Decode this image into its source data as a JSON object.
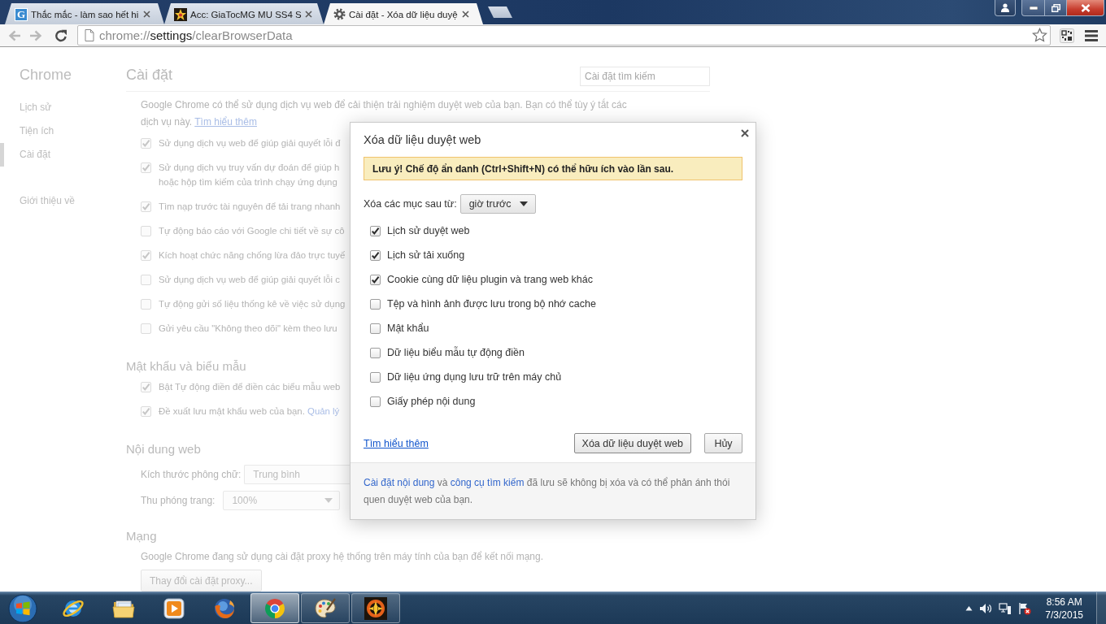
{
  "tabs": [
    {
      "title": "Thắc mắc - làm sao hết hi",
      "kind": "letter",
      "favicon_letter": "G",
      "selected": false
    },
    {
      "title": "Acc: GiaTocMG MU SS4 S",
      "kind": "emblem",
      "selected": false
    },
    {
      "title": "Cài đặt - Xóa dữ liệu duyệ",
      "kind": "gear",
      "selected": true
    }
  ],
  "toolbar": {
    "back_disabled": true,
    "forward_disabled": true,
    "address": {
      "scheme": "chrome://",
      "host": "settings",
      "path": "/clearBrowserData"
    }
  },
  "settings_page": {
    "nav_title": "Chrome",
    "nav_items": [
      {
        "label": "Lịch sử",
        "selected": false
      },
      {
        "label": "Tiện ích",
        "selected": false
      },
      {
        "label": "Cài đặt",
        "selected": true
      }
    ],
    "nav_more_items": [
      {
        "label": "Giới thiệu về",
        "selected": false
      }
    ],
    "title": "Cài đặt",
    "search": {
      "placeholder": "Cài đặt tìm kiếm"
    },
    "intro": [
      {
        "kind": "text",
        "text": "Google Chrome có thể sử dụng dịch vụ web để cải thiện trải nghiệm duyệt web của bạn. Bạn có thể tùy ý tắt các dịch vụ này. "
      },
      {
        "kind": "link",
        "text": "Tìm hiểu thêm"
      }
    ],
    "privacy_options": [
      {
        "lines": [
          "Sử dụng dịch vụ web để giúp giải quyết lỗi đ"
        ],
        "checked": true
      },
      {
        "lines": [
          "Sử dụng dịch vụ truy vấn dự đoán để giúp h",
          "hoặc hộp tìm kiếm của trình chạy ứng dụng"
        ],
        "checked": true
      },
      {
        "lines": [
          "Tìm nạp trước tài nguyên để tải trang nhanh"
        ],
        "checked": true
      },
      {
        "lines": [
          "Tự động báo cáo với Google chi tiết về sự cô"
        ],
        "checked": false
      },
      {
        "lines": [
          "Kích hoạt chức năng chống lừa đảo trực tuyế"
        ],
        "checked": true
      },
      {
        "lines": [
          "Sử dụng dịch vụ web để giúp giải quyết lỗi c"
        ],
        "checked": false
      },
      {
        "lines": [
          "Tự động gửi số liệu thống kê về việc sử dụng"
        ],
        "checked": false
      },
      {
        "lines": [
          "Gửi yêu cầu \"Không theo dõi\" kèm theo lưu"
        ],
        "checked": false
      }
    ],
    "sections": [
      {
        "heading": "Mật khẩu và biểu mẫu",
        "items": [
          {
            "kind": "checkbox",
            "checked": true,
            "parts": [
              {
                "kind": "text",
                "text": "Bật Tự động điền để điền các biểu mẫu web"
              }
            ]
          },
          {
            "kind": "checkbox",
            "checked": true,
            "parts": [
              {
                "kind": "text",
                "text": "Đề xuất lưu mật khẩu web của bạn. "
              },
              {
                "kind": "link",
                "text": "Quản lý"
              }
            ]
          }
        ]
      },
      {
        "heading": "Nội dung web",
        "items": [
          {
            "kind": "select",
            "label": "Kích thước phông chữ:",
            "value": "Trung bình",
            "caret": false
          },
          {
            "kind": "select",
            "label": "Thu phóng trang:",
            "value": "100%",
            "caret": true
          }
        ]
      },
      {
        "heading": "Mạng",
        "items": [
          {
            "kind": "text",
            "text": "Google Chrome đang sử dụng cài đặt proxy hệ thống trên máy tính của bạn để kết nối mạng."
          },
          {
            "kind": "button",
            "label": "Thay đổi cài đặt proxy..."
          }
        ]
      }
    ]
  },
  "dialog": {
    "title": "Xóa dữ liệu duyệt web",
    "notice": "Lưu ý! Chế độ ẩn danh (Ctrl+Shift+N) có thể hữu ích vào lần sau.",
    "range_label": "Xóa các mục sau từ:",
    "range_value": "giờ trước",
    "options": [
      {
        "label": "Lịch sử duyệt web",
        "checked": true
      },
      {
        "label": "Lịch sử tải xuống",
        "checked": true
      },
      {
        "label": "Cookie cùng dữ liệu plugin và trang web khác",
        "checked": true
      },
      {
        "label": "Tệp và hình ảnh được lưu trong bộ nhớ cache",
        "checked": false
      },
      {
        "label": "Mật khẩu",
        "checked": false
      },
      {
        "label": "Dữ liệu biểu mẫu tự động điền",
        "checked": false
      },
      {
        "label": "Dữ liệu ứng dụng lưu trữ trên máy chủ",
        "checked": false
      },
      {
        "label": "Giấy phép nội dung",
        "checked": false
      }
    ],
    "learn_more": "Tìm hiểu thêm",
    "buttons": [
      "Xóa dữ liệu duyệt web",
      "Hủy"
    ],
    "footer_note": [
      {
        "kind": "link",
        "text": "Cài đặt nội dung"
      },
      {
        "kind": "text",
        "text": " và "
      },
      {
        "kind": "link",
        "text": "công cụ tìm kiếm"
      },
      {
        "kind": "text",
        "text": " đã lưu sẽ không bị xóa và có thể phản ánh thói quen duyệt web của bạn."
      }
    ]
  },
  "taskbar": {
    "apps": [
      {
        "kind": "globe-ring",
        "running": false,
        "selected": false
      },
      {
        "kind": "folder",
        "running": false,
        "selected": false
      },
      {
        "kind": "player",
        "running": false,
        "selected": false
      },
      {
        "kind": "fox-globe",
        "running": false,
        "selected": false
      },
      {
        "kind": "tricolor",
        "running": true,
        "selected": true
      },
      {
        "kind": "palette",
        "running": true,
        "selected": false
      },
      {
        "kind": "emblem",
        "running": true,
        "selected": false
      }
    ],
    "clock": {
      "time": "8:56 AM",
      "date": "7/3/2015"
    }
  }
}
